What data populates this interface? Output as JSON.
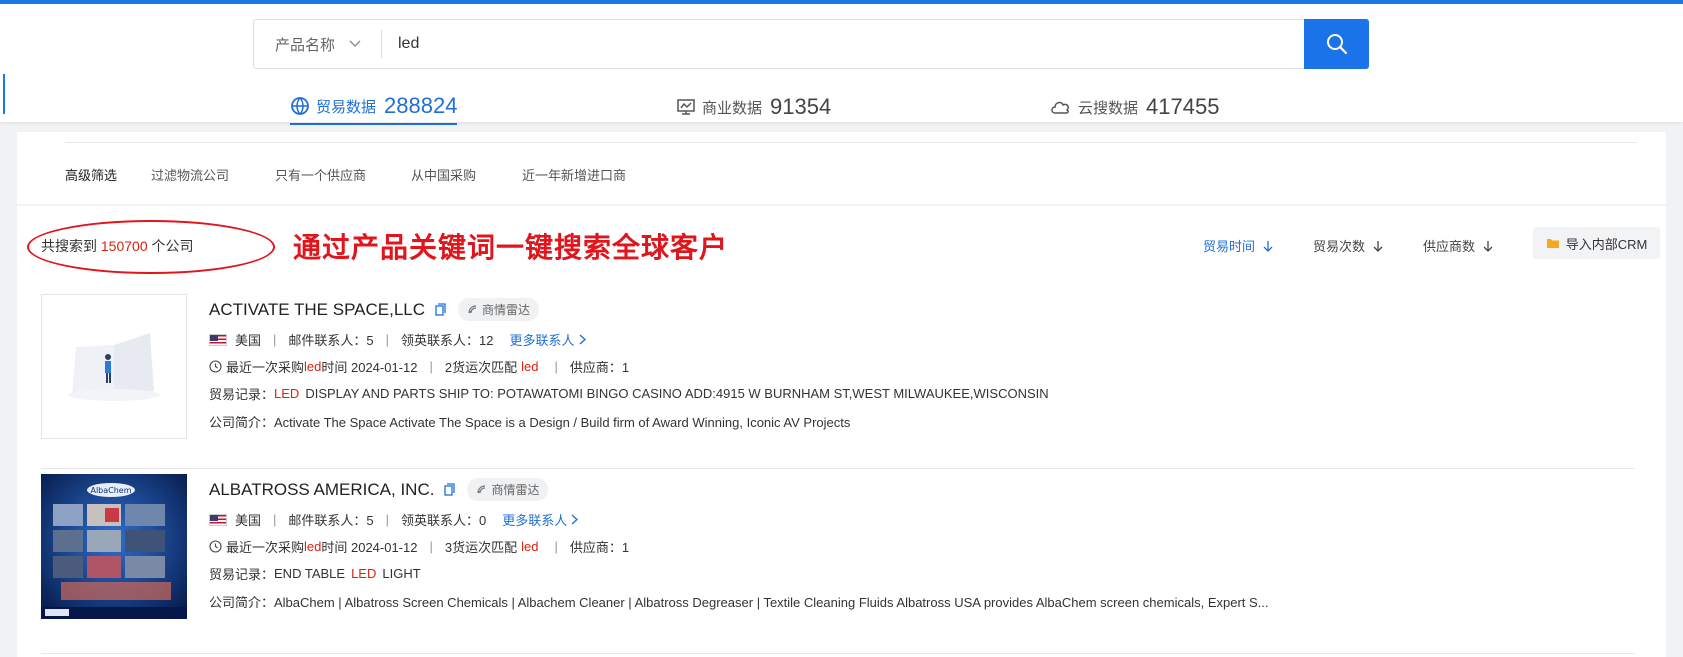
{
  "search": {
    "category": "产品名称",
    "query": "led"
  },
  "tabs": [
    {
      "label": "贸易数据",
      "count": "288824",
      "icon": "globe-icon"
    },
    {
      "label": "商业数据",
      "count": "91354",
      "icon": "monitor-chart-icon"
    },
    {
      "label": "云搜数据",
      "count": "417455",
      "icon": "cloud-icon"
    }
  ],
  "filters": {
    "title": "高级筛选",
    "items": [
      "过滤物流公司",
      "只有一个供应商",
      "从中国采购",
      "近一年新增进口商"
    ]
  },
  "results": {
    "count_prefix": "共搜索到",
    "count": "150700",
    "count_suffix": "个公司",
    "promo": "通过产品关键词一键搜索全球客户"
  },
  "sort": {
    "trade_time": "贸易时间",
    "trade_count": "贸易次数",
    "supplier_count": "供应商数",
    "crm_button": "导入内部CRM"
  },
  "companies": [
    {
      "name": "ACTIVATE THE SPACE,LLC",
      "radar": "商情雷达",
      "country": "美国",
      "email_contacts": "邮件联系人：5",
      "linkedin_contacts": "领英联系人：12",
      "more_contacts": "更多联系人",
      "last_purchase_a": "最近一次采购",
      "keyword": "led",
      "last_purchase_b": "时间 2024-01-12",
      "shipment_match_a": "2货运次匹配",
      "suppliers": "供应商：1",
      "trade_label": "贸易记录：",
      "trade_kw": "LED",
      "trade_rest": "DISPLAY AND PARTS SHIP TO: POTAWATOMI BINGO CASINO ADD:4915 W BURNHAM ST,WEST MILWAUKEE,WISCONSIN",
      "trade_pre": "",
      "intro": "公司简介：Activate The Space Activate The Space is a Design / Build firm of Award Winning, Iconic AV Projects"
    },
    {
      "name": "ALBATROSS AMERICA, INC.",
      "radar": "商情雷达",
      "country": "美国",
      "email_contacts": "邮件联系人：5",
      "linkedin_contacts": "领英联系人：0",
      "more_contacts": "更多联系人",
      "last_purchase_a": "最近一次采购",
      "keyword": "led",
      "last_purchase_b": "时间 2024-01-12",
      "shipment_match_a": "3货运次匹配",
      "suppliers": "供应商：1",
      "trade_label": "贸易记录：",
      "trade_pre": "END TABLE",
      "trade_kw": "LED",
      "trade_rest": "LIGHT",
      "intro": "公司简介：AlbaChem | Albatross Screen Chemicals | Albachem Cleaner | Albatross Degreaser | Textile Cleaning Fluids Albatross USA provides AlbaChem screen chemicals, Expert S..."
    }
  ],
  "brand_logo_text": "AlbaChem",
  "colors": {
    "accent": "#1f6fd8",
    "highlight": "#d9230f",
    "annotation": "#e0161c"
  }
}
